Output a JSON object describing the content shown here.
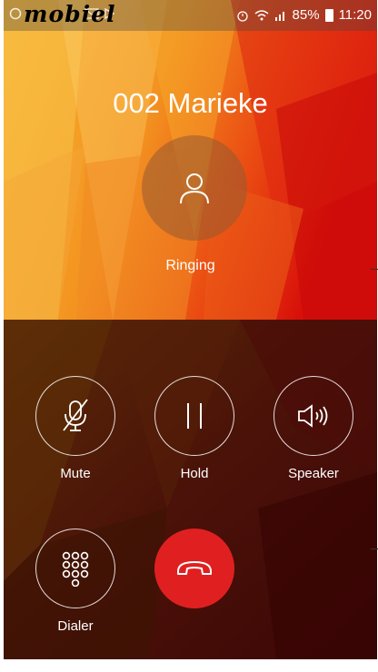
{
  "status_bar": {
    "carrier": "mobiel",
    "battery": "85%",
    "time": "11:20"
  },
  "call": {
    "caller_name": "002 Marieke",
    "state": "Ringing"
  },
  "controls": {
    "mute_label": "Mute",
    "hold_label": "Hold",
    "speaker_label": "Speaker",
    "dialer_label": "Dialer"
  },
  "icons": [
    "whatsapp-icon",
    "email-icon",
    "play-icon",
    "alarm-icon",
    "wifi-icon",
    "signal-icon",
    "battery-icon",
    "person-icon",
    "mic-off-icon",
    "pause-icon",
    "speaker-icon",
    "dialpad-icon",
    "end-call-icon"
  ],
  "colors": {
    "end_call": "#e02020",
    "top_gradient_light": "#f7b332",
    "top_gradient_dark": "#e2150c",
    "bottom_panel": "#4a0f08"
  }
}
